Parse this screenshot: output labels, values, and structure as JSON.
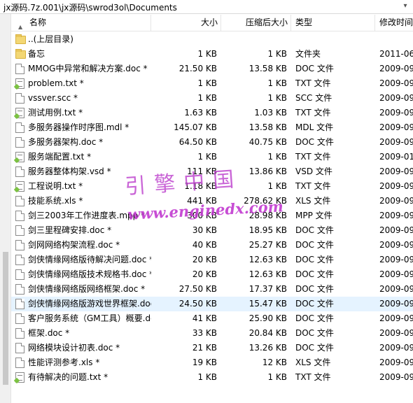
{
  "path": "jx源码.7z.001\\jx源码\\swrod3ol\\Documents",
  "columns": {
    "name": "名称",
    "size": "大小",
    "csize": "压缩后大小",
    "type": "类型",
    "date": "修改时间"
  },
  "rows": [
    {
      "icon": "folder",
      "name": "..(上层目录)",
      "size": "",
      "csize": "",
      "type": "",
      "date": ""
    },
    {
      "icon": "folder",
      "name": "备忘",
      "size": "1 KB",
      "csize": "1 KB",
      "type": "文件夹",
      "date": "2011-06"
    },
    {
      "icon": "file",
      "name": "MMOG中异常和解决方案.doc *",
      "size": "21.50 KB",
      "csize": "13.58 KB",
      "type": "DOC 文件",
      "date": "2009-09"
    },
    {
      "icon": "txt",
      "name": "problem.txt *",
      "size": "1 KB",
      "csize": "1 KB",
      "type": "TXT 文件",
      "date": "2009-09"
    },
    {
      "icon": "file",
      "name": "vssver.scc *",
      "size": "1 KB",
      "csize": "1 KB",
      "type": "SCC 文件",
      "date": "2009-09"
    },
    {
      "icon": "txt",
      "name": "测试用例.txt *",
      "size": "1.63 KB",
      "csize": "1.03 KB",
      "type": "TXT 文件",
      "date": "2009-09"
    },
    {
      "icon": "file",
      "name": "多服务器操作时序图.mdl *",
      "size": "145.07 KB",
      "csize": "13.58 KB",
      "type": "MDL 文件",
      "date": "2009-09"
    },
    {
      "icon": "file",
      "name": "多服务器架构.doc *",
      "size": "64.50 KB",
      "csize": "40.75 KB",
      "type": "DOC 文件",
      "date": "2009-09"
    },
    {
      "icon": "txt",
      "name": "服务端配置.txt *",
      "size": "1 KB",
      "csize": "1 KB",
      "type": "TXT 文件",
      "date": "2009-01"
    },
    {
      "icon": "file",
      "name": "服务器整体构架.vsd *",
      "size": "111 KB",
      "csize": "13.86 KB",
      "type": "VSD 文件",
      "date": "2009-09"
    },
    {
      "icon": "txt",
      "name": "工程说明.txt *",
      "size": "1.18 KB",
      "csize": "1 KB",
      "type": "TXT 文件",
      "date": "2009-09"
    },
    {
      "icon": "file",
      "name": "技能系统.xls *",
      "size": "441 KB",
      "csize": "278.62 KB",
      "type": "XLS 文件",
      "date": "2009-09"
    },
    {
      "icon": "file",
      "name": "剑三2003年工作进度表.mpp *",
      "size": "300 KB",
      "csize": "28.98 KB",
      "type": "MPP 文件",
      "date": "2009-09"
    },
    {
      "icon": "file",
      "name": "剑三里程碑安排.doc *",
      "size": "30 KB",
      "csize": "18.95 KB",
      "type": "DOC 文件",
      "date": "2009-09"
    },
    {
      "icon": "file",
      "name": "剑网网络构架流程.doc *",
      "size": "40 KB",
      "csize": "25.27 KB",
      "type": "DOC 文件",
      "date": "2009-09"
    },
    {
      "icon": "file",
      "name": "剑侠情缘网络版待解决问题.doc *",
      "size": "20 KB",
      "csize": "12.63 KB",
      "type": "DOC 文件",
      "date": "2009-09"
    },
    {
      "icon": "file",
      "name": "剑侠情缘网络版技术规格书.doc *",
      "size": "20 KB",
      "csize": "12.63 KB",
      "type": "DOC 文件",
      "date": "2009-09"
    },
    {
      "icon": "file",
      "name": "剑侠情缘网络版网络框架.doc *",
      "size": "27.50 KB",
      "csize": "17.37 KB",
      "type": "DOC 文件",
      "date": "2009-09"
    },
    {
      "icon": "file",
      "name": "剑侠情缘网络版游戏世界框架.doc *",
      "size": "24.50 KB",
      "csize": "15.47 KB",
      "type": "DOC 文件",
      "date": "2009-09",
      "selected": true
    },
    {
      "icon": "file",
      "name": "客户服务系统（GM工具）概要.doc *",
      "size": "41 KB",
      "csize": "25.90 KB",
      "type": "DOC 文件",
      "date": "2009-09"
    },
    {
      "icon": "file",
      "name": "框架.doc *",
      "size": "33 KB",
      "csize": "20.84 KB",
      "type": "DOC 文件",
      "date": "2009-09"
    },
    {
      "icon": "file",
      "name": "网络模块设计初表.doc *",
      "size": "21 KB",
      "csize": "13.26 KB",
      "type": "DOC 文件",
      "date": "2009-09"
    },
    {
      "icon": "file",
      "name": "性能评测参考.xls *",
      "size": "19 KB",
      "csize": "12 KB",
      "type": "XLS 文件",
      "date": "2009-09"
    },
    {
      "icon": "txt",
      "name": "有待解决的问题.txt *",
      "size": "1 KB",
      "csize": "1 KB",
      "type": "TXT 文件",
      "date": "2009-09"
    }
  ],
  "watermark": {
    "line1": "引擎中国",
    "line2": "www.enginedx.com"
  }
}
